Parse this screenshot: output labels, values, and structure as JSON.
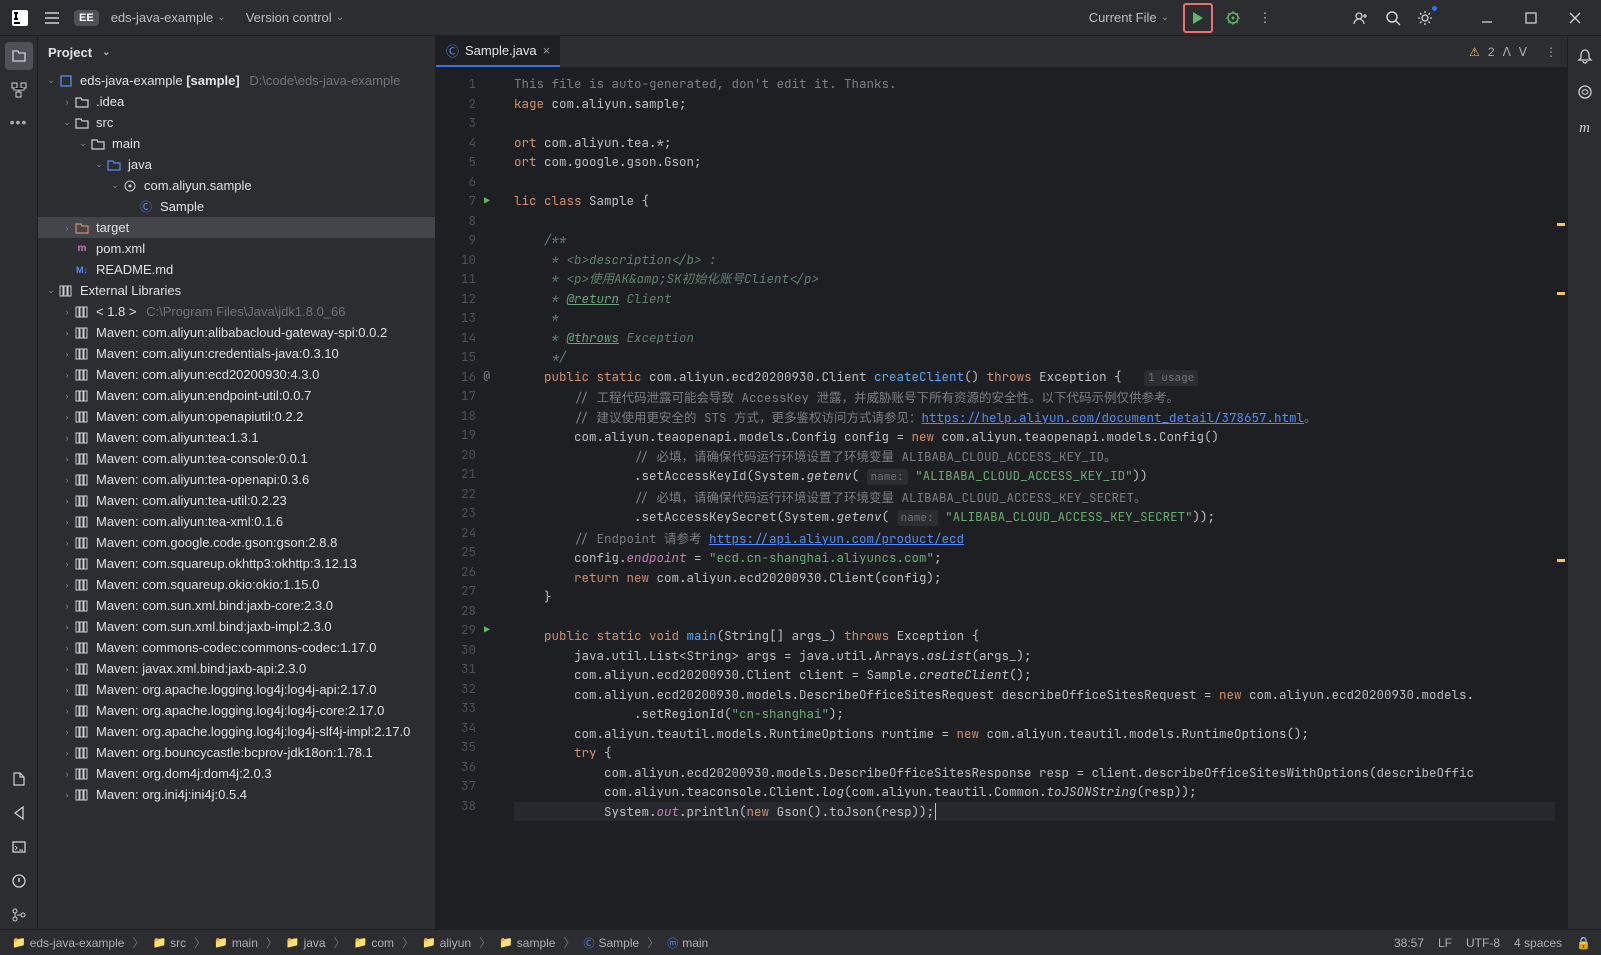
{
  "titlebar": {
    "project_badge": "EE",
    "project_name": "eds-java-example",
    "menu_version_control": "Version control",
    "run_config": "Current File"
  },
  "project_pane": {
    "title": "Project"
  },
  "tree": {
    "root": {
      "label": "eds-java-example",
      "bold_suffix": "[sample]",
      "path": "D:\\code\\eds-java-example"
    },
    "idea": ".idea",
    "src": "src",
    "main": "main",
    "java": "java",
    "pkg": "com.aliyun.sample",
    "sample": "Sample",
    "target": "target",
    "pom": "pom.xml",
    "readme": "README.md",
    "extlib": "External Libraries",
    "jdk": {
      "label": "< 1.8 >",
      "path": "C:\\Program Files\\Java\\jdk1.8.0_66"
    },
    "libs": [
      "Maven: com.aliyun:alibabacloud-gateway-spi:0.0.2",
      "Maven: com.aliyun:credentials-java:0.3.10",
      "Maven: com.aliyun:ecd20200930:4.3.0",
      "Maven: com.aliyun:endpoint-util:0.0.7",
      "Maven: com.aliyun:openapiutil:0.2.2",
      "Maven: com.aliyun:tea:1.3.1",
      "Maven: com.aliyun:tea-console:0.0.1",
      "Maven: com.aliyun:tea-openapi:0.3.6",
      "Maven: com.aliyun:tea-util:0.2.23",
      "Maven: com.aliyun:tea-xml:0.1.6",
      "Maven: com.google.code.gson:gson:2.8.8",
      "Maven: com.squareup.okhttp3:okhttp:3.12.13",
      "Maven: com.squareup.okio:okio:1.15.0",
      "Maven: com.sun.xml.bind:jaxb-core:2.3.0",
      "Maven: com.sun.xml.bind:jaxb-impl:2.3.0",
      "Maven: commons-codec:commons-codec:1.17.0",
      "Maven: javax.xml.bind:jaxb-api:2.3.0",
      "Maven: org.apache.logging.log4j:log4j-api:2.17.0",
      "Maven: org.apache.logging.log4j:log4j-core:2.17.0",
      "Maven: org.apache.logging.log4j:log4j-slf4j-impl:2.17.0",
      "Maven: org.bouncycastle:bcprov-jdk18on:1.78.1",
      "Maven: org.dom4j:dom4j:2.0.3",
      "Maven: org.ini4j:ini4j:0.5.4"
    ]
  },
  "tab": {
    "filename": "Sample.java",
    "warnings": "2"
  },
  "code": {
    "usage_hint": "1 usage",
    "name_hint1": "name:",
    "name_hint2": "name:"
  },
  "breadcrumbs": [
    "eds-java-example",
    "src",
    "main",
    "java",
    "com",
    "aliyun",
    "sample",
    "Sample",
    "main"
  ],
  "status": {
    "pos": "38:57",
    "linesep": "LF",
    "encoding": "UTF-8",
    "indent": "4 spaces"
  }
}
